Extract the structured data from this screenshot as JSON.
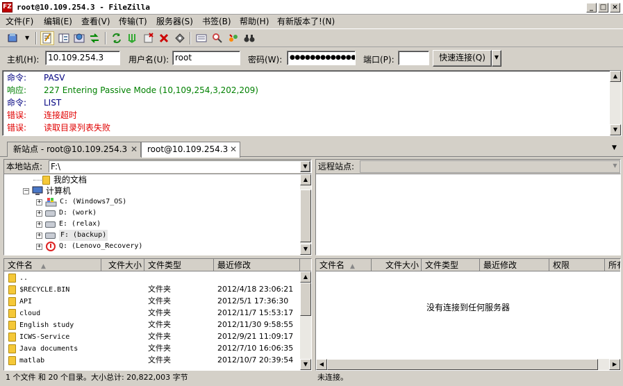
{
  "window": {
    "title": "root@10.109.254.3 - FileZilla",
    "icon_label": "FZ"
  },
  "menu": [
    "文件(F)",
    "编辑(E)",
    "查看(V)",
    "传输(T)",
    "服务器(S)",
    "书签(B)",
    "帮助(H)",
    "有新版本了!(N)"
  ],
  "quickconnect": {
    "host_label": "主机(H):",
    "host_value": "10.109.254.3",
    "user_label": "用户名(U):",
    "user_value": "root",
    "pass_label": "密码(W):",
    "pass_value": "●●●●●●●●●●●●●●",
    "port_label": "端口(P):",
    "port_value": "",
    "connect_label": "快速连接(Q)"
  },
  "log": [
    {
      "prefix": "命令:",
      "text": "PASV",
      "color": "#000080"
    },
    {
      "prefix": "响应:",
      "text": "227 Entering Passive Mode (10,109,254,3,202,209)",
      "color": "#008000"
    },
    {
      "prefix": "命令:",
      "text": "LIST",
      "color": "#000080"
    },
    {
      "prefix": "错误:",
      "text": "连接超时",
      "color": "#ff0000"
    },
    {
      "prefix": "错误:",
      "text": "读取目录列表失败",
      "color": "#ff0000"
    }
  ],
  "tabs": [
    {
      "label": "新站点 - root@10.109.254.3",
      "active": false
    },
    {
      "label": "root@10.109.254.3",
      "active": true
    }
  ],
  "local": {
    "site_label": "本地站点:",
    "path": "F:\\",
    "tree": [
      {
        "label": "我的文档",
        "icon": "documents-folder-icon"
      },
      {
        "label": "计算机",
        "icon": "computer-icon"
      },
      {
        "label": "C: (Windows7_OS)",
        "icon": "system-drive-icon"
      },
      {
        "label": "D: (work)",
        "icon": "drive-icon"
      },
      {
        "label": "E: (relax)",
        "icon": "drive-icon"
      },
      {
        "label": "F: (backup)",
        "icon": "drive-icon",
        "selected": true
      },
      {
        "label": "Q: (Lenovo_Recovery)",
        "icon": "recovery-drive-icon"
      }
    ],
    "columns": [
      "文件名",
      "文件大小",
      "文件类型",
      "最近修改"
    ],
    "files": [
      {
        "name": "..",
        "type": "",
        "modified": ""
      },
      {
        "name": "$RECYCLE.BIN",
        "type": "文件夹",
        "modified": "2012/4/18 23:06:21"
      },
      {
        "name": "API",
        "type": "文件夹",
        "modified": "2012/5/1 17:36:30"
      },
      {
        "name": "cloud",
        "type": "文件夹",
        "modified": "2012/11/7 15:53:17"
      },
      {
        "name": "English study",
        "type": "文件夹",
        "modified": "2012/11/30 9:58:55"
      },
      {
        "name": "ICWS-Service",
        "type": "文件夹",
        "modified": "2012/9/21 11:09:17"
      },
      {
        "name": "Java documents",
        "type": "文件夹",
        "modified": "2012/7/10 16:06:35"
      },
      {
        "name": "matlab",
        "type": "文件夹",
        "modified": "2012/10/7 20:39:54"
      }
    ],
    "status": "1 个文件 和 20 个目录。大小总计: 20,822,003 字节"
  },
  "remote": {
    "site_label": "远程站点:",
    "path": "",
    "columns": [
      "文件名",
      "文件大小",
      "文件类型",
      "最近修改",
      "权限",
      "所有"
    ],
    "empty_message": "没有连接到任何服务器",
    "status": "未连接。"
  }
}
